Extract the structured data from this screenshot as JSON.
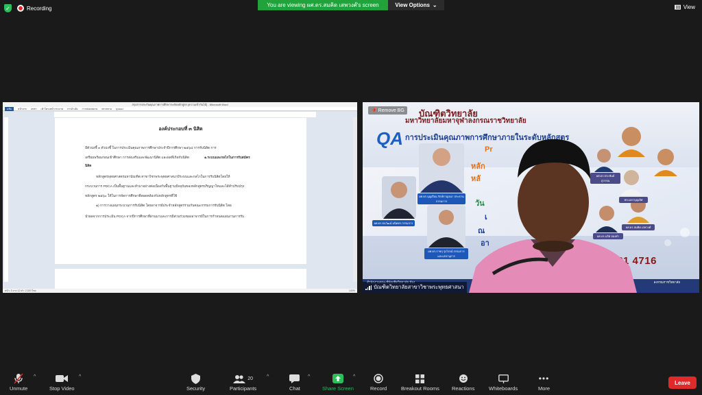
{
  "topbar": {
    "recording_label": "Recording",
    "viewing_banner": "You are viewing ผศ.ดร.สมคิด เสพวงศ์'s screen",
    "view_options_label": "View Options",
    "view_label": "View"
  },
  "shared_doc": {
    "window_title": "สรุปการประกันคุณภาพการศึกษาระดับหลักสูตร [ความเข้ากันได้] - Microsoft Word",
    "ribbon_tabs": [
      "แฟ้ม",
      "หน้าแรก",
      "แทรก",
      "เค้าโครงหน้ากระดาษ",
      "การอ้างอิง",
      "การส่งจดหมาย",
      "ตรวจทาน",
      "มุมมอง"
    ],
    "heading": "องค์ประกอบที่ ๓ นิสิต",
    "lines": [
      "มีตัวบ่งชี้ ๓ ตัวบ่งชี้ ในการประเมินคุณภาพการศึกษาประจำปีการศึกษา ๒๕๖๔ การรับนิสิต การ",
      "เตรียมพร้อมก่อนเข้าศึกษา การส่งเสริมและพัฒนานิสิต และผลที่เกิดกับนิสิต",
      "๑.ระบบและกลไกในการรับสมัคร",
      "นิสิต",
      "หลักสูตรพุทธศาสตรมหาบัณฑิต สาขาวิชาพระพุทธศาสนามีระบบและกลไกในการรับนิสิตโดยให้",
      "กระบวนการ PDCA เป็นพื้นฐานและทำมาอย่างต่อเนื่องกับพื้นฐานปัจจุบันของหลักสูตรปริญญาโทและได้ทำปรับปรุง",
      "หลักสูตร ๒๕๖๐ ให้ในการจัดการศึกษาที่สอดคล้องกับหลักสูตรที่ใช้",
      "๑) การวางแผนกระบวนการรับนิสิต โดยอาจารย์ประจำหลักสูตรร่วมกับคณะกรรมการรับนิสิต โดย",
      "นำผลจากการประเมิน PDCA จากปีการศึกษาที่ผ่านมาและการมีส่วนร่วมของอาจารย์ในการกำหนดแผนงานการรับ"
    ],
    "status_left": "หน้า: 3 จาก 12   คำ: 2,320   ไทย",
    "zoom": "140%"
  },
  "video": {
    "remove_bg_label": "Remove BG",
    "poster_title1": "บัณฑิตวิทยาลัย",
    "poster_title2": "มหาวิทยาลัยมหาจุฬาลงกรณราชวิทยาลัย",
    "poster_qa": "QA",
    "poster_title3": "การประเมินคุณภาพการศึกษาภายในระดับหลักสูตร",
    "poster_year_fragment": "Pr",
    "poster_year_end": "64",
    "poster_line_a": "หลัก",
    "poster_line_b": "หลั",
    "poster_line_c": "วัน",
    "poster_line_d": "เ",
    "poster_line_e": "ณ",
    "poster_line_f": "อา",
    "phone_fragment": "04 081 4716",
    "bottom_left_text": "สำนักงานคณะพี่บัณฑิตวิทยาลัย ห้อง",
    "bottom_right_text": "ลงกรณราชวิทยาลัย",
    "captions": [
      "ผศ.ดร.บุญเรือน รักษ์กาญจนา ประธานกรรมการ",
      "ผศ.ดร.ธนวัฒน์ มนิดทร กรรมการ",
      "ผศ.ดร.ราชฤ รุ่งโรจน์ กรรมการและเลขานุการ",
      "ผศ.ดร.ประพันธ์ สุวรรณ",
      "ผศ.ดร.นริศ อ่องคำ",
      "พระมหาบุญเลิศ",
      "ผศ.ดร.สมคิด เสพวงศ์"
    ],
    "participant_name": "บัณฑิตวิทยาลัยสาขาวิชาพระพุทธศาสนา"
  },
  "toolbar": {
    "mute_label": "Unmute",
    "video_label": "Stop Video",
    "security_label": "Security",
    "participants_label": "Participants",
    "participants_count": "20",
    "chat_label": "Chat",
    "share_label": "Share Screen",
    "record_label": "Record",
    "breakout_label": "Breakout Rooms",
    "reactions_label": "Reactions",
    "whiteboards_label": "Whiteboards",
    "more_label": "More",
    "leave_label": "Leave"
  },
  "colors": {
    "banner_green": "#1fa33a",
    "share_green": "#2dbd5a",
    "leave_red": "#e0292b"
  }
}
